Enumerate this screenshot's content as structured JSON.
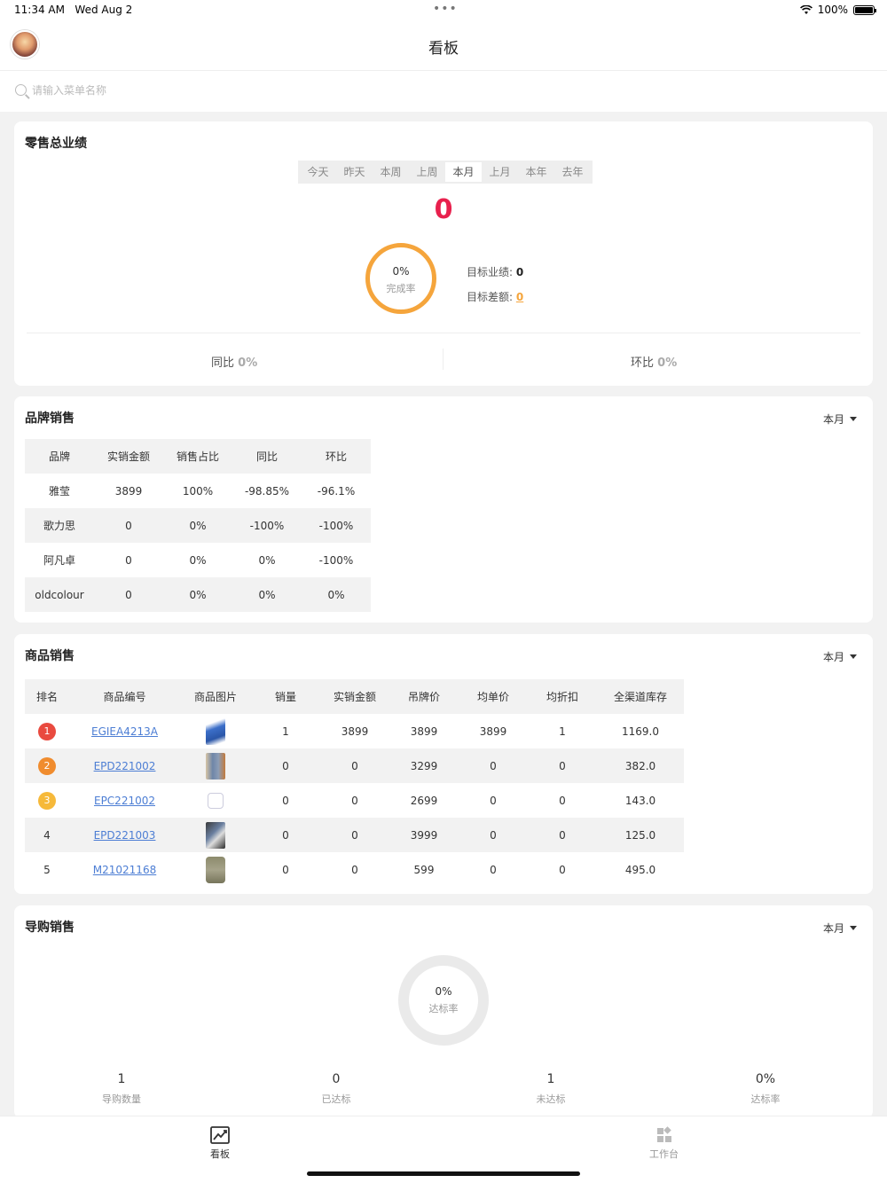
{
  "status": {
    "time": "11:34 AM",
    "date": "Wed Aug 2",
    "battery": "100%"
  },
  "nav": {
    "title": "看板"
  },
  "search": {
    "placeholder": "请输入菜单名称"
  },
  "retail": {
    "title": "零售总业绩",
    "tabs": [
      "今天",
      "昨天",
      "本周",
      "上周",
      "本月",
      "上月",
      "本年",
      "去年"
    ],
    "active_tab": "本月",
    "total": "0",
    "completion_pct": "0%",
    "completion_label": "完成率",
    "target_label": "目标业绩:",
    "target_value": "0",
    "gap_label": "目标差额:",
    "gap_value": "0",
    "yoy_label": "同比",
    "yoy_value": "0%",
    "mom_label": "环比",
    "mom_value": "0%"
  },
  "brand": {
    "title": "品牌销售",
    "period": "本月",
    "headers": [
      "品牌",
      "实销金额",
      "销售占比",
      "同比",
      "环比"
    ],
    "rows": [
      [
        "雅莹",
        "3899",
        "100%",
        "-98.85%",
        "-96.1%"
      ],
      [
        "歌力思",
        "0",
        "0%",
        "-100%",
        "-100%"
      ],
      [
        "阿凡卓",
        "0",
        "0%",
        "0%",
        "-100%"
      ],
      [
        "oldcolour",
        "0",
        "0%",
        "0%",
        "0%"
      ]
    ]
  },
  "product": {
    "title": "商品销售",
    "period": "本月",
    "headers": [
      "排名",
      "商品编号",
      "商品图片",
      "销量",
      "实销金额",
      "吊牌价",
      "均单价",
      "均折扣",
      "全渠道库存"
    ],
    "rows": [
      {
        "rank": "1",
        "sku": "EGIEA4213A",
        "qty": "1",
        "amount": "3899",
        "tag_price": "3899",
        "avg_price": "3899",
        "avg_discount": "1",
        "stock": "1169.0"
      },
      {
        "rank": "2",
        "sku": "EPD221002",
        "qty": "0",
        "amount": "0",
        "tag_price": "3299",
        "avg_price": "0",
        "avg_discount": "0",
        "stock": "382.0"
      },
      {
        "rank": "3",
        "sku": "EPC221002",
        "qty": "0",
        "amount": "0",
        "tag_price": "2699",
        "avg_price": "0",
        "avg_discount": "0",
        "stock": "143.0"
      },
      {
        "rank": "4",
        "sku": "EPD221003",
        "qty": "0",
        "amount": "0",
        "tag_price": "3999",
        "avg_price": "0",
        "avg_discount": "0",
        "stock": "125.0"
      },
      {
        "rank": "5",
        "sku": "M21021168",
        "qty": "0",
        "amount": "0",
        "tag_price": "599",
        "avg_price": "0",
        "avg_discount": "0",
        "stock": "495.0"
      }
    ]
  },
  "guide": {
    "title": "导购销售",
    "period": "本月",
    "rate_pct": "0%",
    "rate_label": "达标率",
    "stats": [
      {
        "value": "1",
        "label": "导购数量"
      },
      {
        "value": "0",
        "label": "已达标"
      },
      {
        "value": "1",
        "label": "未达标"
      },
      {
        "value": "0%",
        "label": "达标率"
      }
    ]
  },
  "tabbar": {
    "dashboard": "看板",
    "workbench": "工作台"
  },
  "colors": {
    "accent_red": "#e8204d",
    "ring_orange": "#f5a53c",
    "link_blue": "#4d7ed4"
  }
}
